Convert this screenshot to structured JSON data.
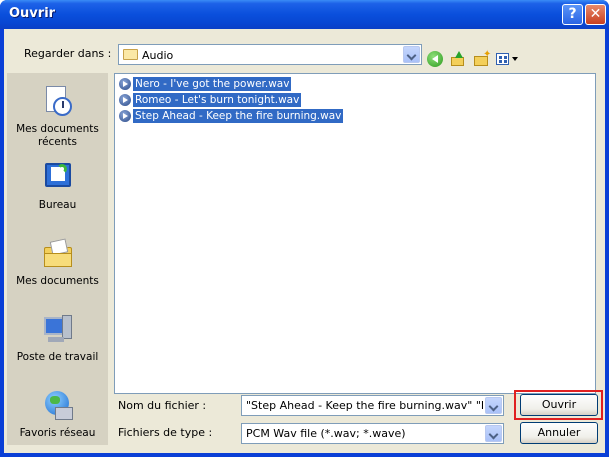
{
  "window": {
    "title": "Ouvrir",
    "help_label": "?",
    "close_label": "✕"
  },
  "lookin": {
    "label": "Regarder dans :",
    "value": "Audio"
  },
  "toolbar": {
    "icons": [
      "back-icon",
      "up-folder-icon",
      "new-folder-icon",
      "views-menu-icon"
    ]
  },
  "places": [
    {
      "label": "Mes documents récents",
      "icon": "recent-documents-icon"
    },
    {
      "label": "Bureau",
      "icon": "desktop-icon"
    },
    {
      "label": "Mes documents",
      "icon": "my-documents-icon"
    },
    {
      "label": "Poste de travail",
      "icon": "my-computer-icon"
    },
    {
      "label": "Favoris réseau",
      "icon": "network-places-icon"
    }
  ],
  "files": [
    {
      "name": "Nero -  I've got the power.wav",
      "selected": true
    },
    {
      "name": "Romeo -  Let's burn tonight.wav",
      "selected": true
    },
    {
      "name": "Step Ahead - Keep the fire burning.wav",
      "selected": true
    }
  ],
  "filename": {
    "label": "Nom du fichier :",
    "value": "\"Step Ahead - Keep the fire burning.wav\" \"Nerc"
  },
  "filetype": {
    "label": "Fichiers de type :",
    "value": "PCM Wav file (*.wav; *.wave)"
  },
  "buttons": {
    "open": "Ouvrir",
    "cancel": "Annuler"
  },
  "colors": {
    "titlebar": "#0a4fdc",
    "selection": "#316ac5",
    "highlight_ring": "#e02020"
  }
}
